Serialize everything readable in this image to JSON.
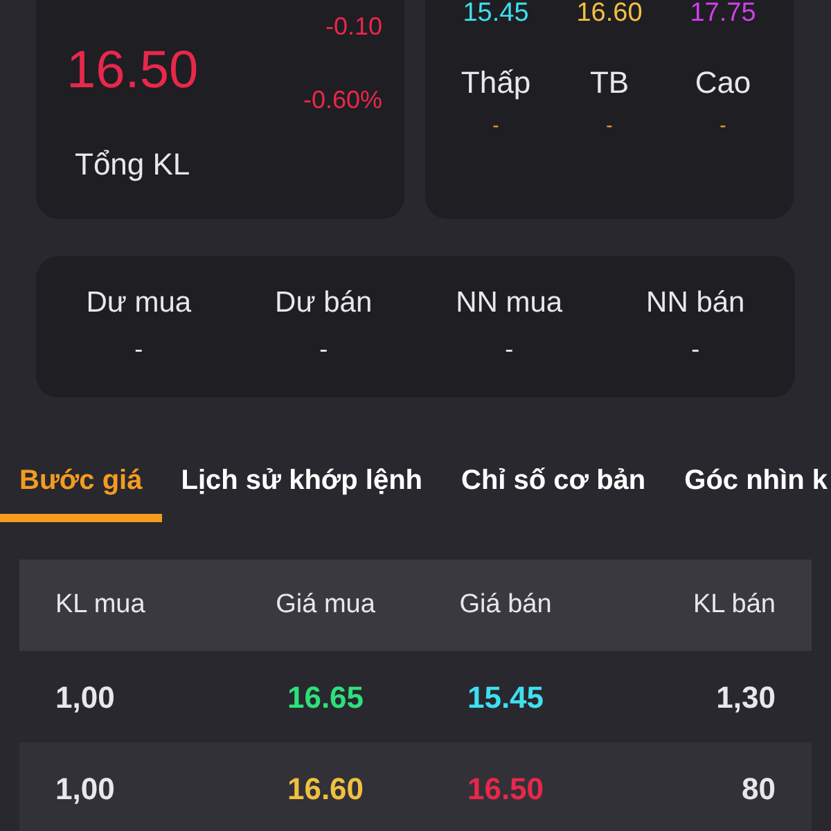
{
  "quote": {
    "price": "16.50",
    "change": "-0.10",
    "change_pct": "-0.60%",
    "volume_label": "Tổng KL"
  },
  "range": [
    {
      "value": "15.45",
      "label": "Thấp",
      "dash": "-",
      "color": "#3ee0f0"
    },
    {
      "value": "16.60",
      "label": "TB",
      "dash": "-",
      "color": "#f0c040"
    },
    {
      "value": "17.75",
      "label": "Cao",
      "dash": "-",
      "color": "#d040e8"
    }
  ],
  "stats": [
    {
      "label": "Dư mua",
      "value": "-"
    },
    {
      "label": "Dư bán",
      "value": "-"
    },
    {
      "label": "NN mua",
      "value": "-"
    },
    {
      "label": "NN bán",
      "value": "-"
    }
  ],
  "tabs": [
    {
      "label": "Bước giá",
      "selected": true
    },
    {
      "label": "Lịch sử khớp lệnh",
      "selected": false
    },
    {
      "label": "Chỉ số cơ bản",
      "selected": false
    },
    {
      "label": "Góc nhìn k",
      "selected": false
    }
  ],
  "table": {
    "columns": [
      "KL mua",
      "Giá mua",
      "Giá bán",
      "KL bán"
    ],
    "rows": [
      {
        "buy_volume": "1,00",
        "bid": {
          "text": "16.65",
          "color": "#2ee07a"
        },
        "ask": {
          "text": "15.45",
          "color": "#3ee0f0"
        },
        "sell_volume": "1,30"
      },
      {
        "buy_volume": "1,00",
        "bid": {
          "text": "16.60",
          "color": "#f0c040"
        },
        "ask": {
          "text": "16.50",
          "color": "#e8284a"
        },
        "sell_volume": "80"
      }
    ]
  }
}
